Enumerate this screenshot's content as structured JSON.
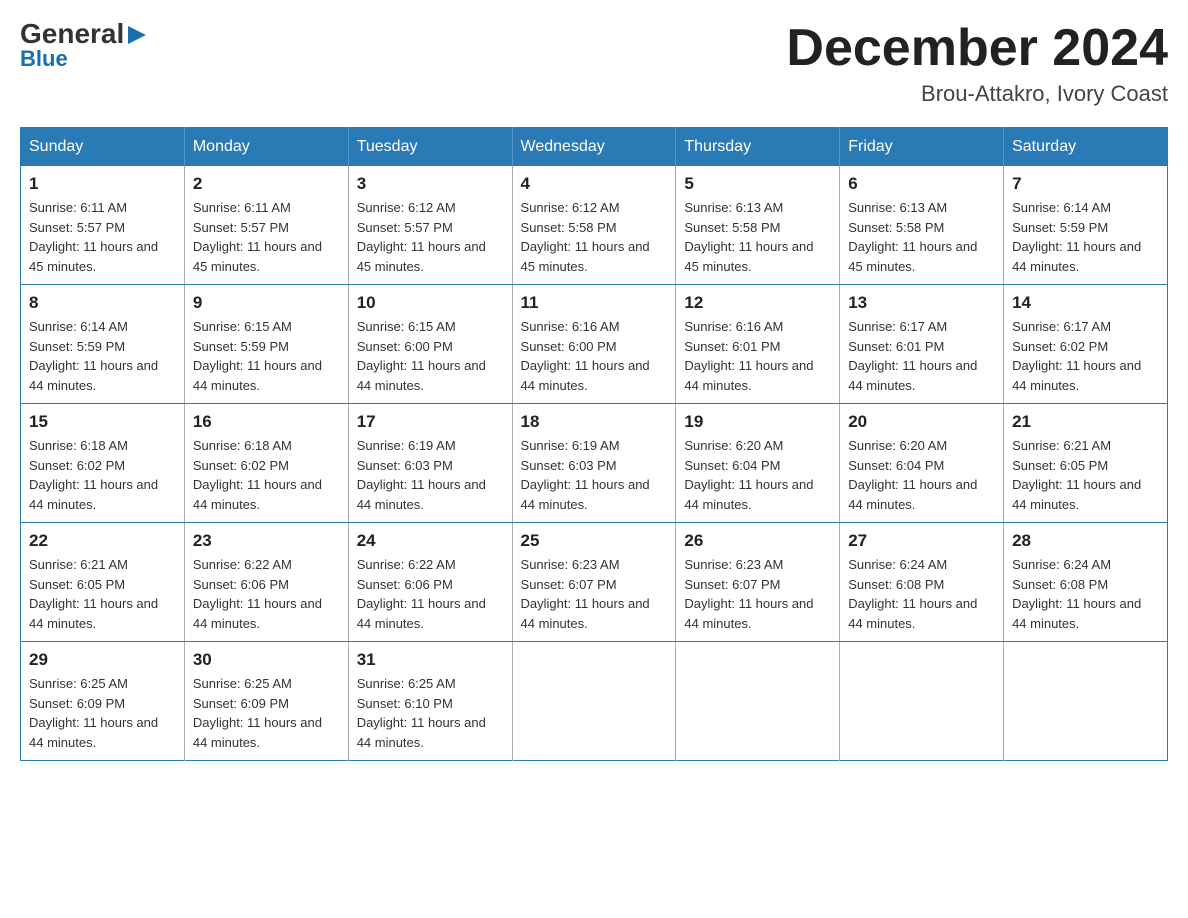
{
  "logo": {
    "general": "General",
    "blue": "Blue"
  },
  "title": {
    "month_year": "December 2024",
    "location": "Brou-Attakro, Ivory Coast"
  },
  "days_of_week": [
    "Sunday",
    "Monday",
    "Tuesday",
    "Wednesday",
    "Thursday",
    "Friday",
    "Saturday"
  ],
  "weeks": [
    [
      {
        "day": "1",
        "sunrise": "6:11 AM",
        "sunset": "5:57 PM",
        "daylight": "11 hours and 45 minutes."
      },
      {
        "day": "2",
        "sunrise": "6:11 AM",
        "sunset": "5:57 PM",
        "daylight": "11 hours and 45 minutes."
      },
      {
        "day": "3",
        "sunrise": "6:12 AM",
        "sunset": "5:57 PM",
        "daylight": "11 hours and 45 minutes."
      },
      {
        "day": "4",
        "sunrise": "6:12 AM",
        "sunset": "5:58 PM",
        "daylight": "11 hours and 45 minutes."
      },
      {
        "day": "5",
        "sunrise": "6:13 AM",
        "sunset": "5:58 PM",
        "daylight": "11 hours and 45 minutes."
      },
      {
        "day": "6",
        "sunrise": "6:13 AM",
        "sunset": "5:58 PM",
        "daylight": "11 hours and 45 minutes."
      },
      {
        "day": "7",
        "sunrise": "6:14 AM",
        "sunset": "5:59 PM",
        "daylight": "11 hours and 44 minutes."
      }
    ],
    [
      {
        "day": "8",
        "sunrise": "6:14 AM",
        "sunset": "5:59 PM",
        "daylight": "11 hours and 44 minutes."
      },
      {
        "day": "9",
        "sunrise": "6:15 AM",
        "sunset": "5:59 PM",
        "daylight": "11 hours and 44 minutes."
      },
      {
        "day": "10",
        "sunrise": "6:15 AM",
        "sunset": "6:00 PM",
        "daylight": "11 hours and 44 minutes."
      },
      {
        "day": "11",
        "sunrise": "6:16 AM",
        "sunset": "6:00 PM",
        "daylight": "11 hours and 44 minutes."
      },
      {
        "day": "12",
        "sunrise": "6:16 AM",
        "sunset": "6:01 PM",
        "daylight": "11 hours and 44 minutes."
      },
      {
        "day": "13",
        "sunrise": "6:17 AM",
        "sunset": "6:01 PM",
        "daylight": "11 hours and 44 minutes."
      },
      {
        "day": "14",
        "sunrise": "6:17 AM",
        "sunset": "6:02 PM",
        "daylight": "11 hours and 44 minutes."
      }
    ],
    [
      {
        "day": "15",
        "sunrise": "6:18 AM",
        "sunset": "6:02 PM",
        "daylight": "11 hours and 44 minutes."
      },
      {
        "day": "16",
        "sunrise": "6:18 AM",
        "sunset": "6:02 PM",
        "daylight": "11 hours and 44 minutes."
      },
      {
        "day": "17",
        "sunrise": "6:19 AM",
        "sunset": "6:03 PM",
        "daylight": "11 hours and 44 minutes."
      },
      {
        "day": "18",
        "sunrise": "6:19 AM",
        "sunset": "6:03 PM",
        "daylight": "11 hours and 44 minutes."
      },
      {
        "day": "19",
        "sunrise": "6:20 AM",
        "sunset": "6:04 PM",
        "daylight": "11 hours and 44 minutes."
      },
      {
        "day": "20",
        "sunrise": "6:20 AM",
        "sunset": "6:04 PM",
        "daylight": "11 hours and 44 minutes."
      },
      {
        "day": "21",
        "sunrise": "6:21 AM",
        "sunset": "6:05 PM",
        "daylight": "11 hours and 44 minutes."
      }
    ],
    [
      {
        "day": "22",
        "sunrise": "6:21 AM",
        "sunset": "6:05 PM",
        "daylight": "11 hours and 44 minutes."
      },
      {
        "day": "23",
        "sunrise": "6:22 AM",
        "sunset": "6:06 PM",
        "daylight": "11 hours and 44 minutes."
      },
      {
        "day": "24",
        "sunrise": "6:22 AM",
        "sunset": "6:06 PM",
        "daylight": "11 hours and 44 minutes."
      },
      {
        "day": "25",
        "sunrise": "6:23 AM",
        "sunset": "6:07 PM",
        "daylight": "11 hours and 44 minutes."
      },
      {
        "day": "26",
        "sunrise": "6:23 AM",
        "sunset": "6:07 PM",
        "daylight": "11 hours and 44 minutes."
      },
      {
        "day": "27",
        "sunrise": "6:24 AM",
        "sunset": "6:08 PM",
        "daylight": "11 hours and 44 minutes."
      },
      {
        "day": "28",
        "sunrise": "6:24 AM",
        "sunset": "6:08 PM",
        "daylight": "11 hours and 44 minutes."
      }
    ],
    [
      {
        "day": "29",
        "sunrise": "6:25 AM",
        "sunset": "6:09 PM",
        "daylight": "11 hours and 44 minutes."
      },
      {
        "day": "30",
        "sunrise": "6:25 AM",
        "sunset": "6:09 PM",
        "daylight": "11 hours and 44 minutes."
      },
      {
        "day": "31",
        "sunrise": "6:25 AM",
        "sunset": "6:10 PM",
        "daylight": "11 hours and 44 minutes."
      },
      null,
      null,
      null,
      null
    ]
  ],
  "labels": {
    "sunrise_prefix": "Sunrise: ",
    "sunset_prefix": "Sunset: ",
    "daylight_prefix": "Daylight: "
  }
}
